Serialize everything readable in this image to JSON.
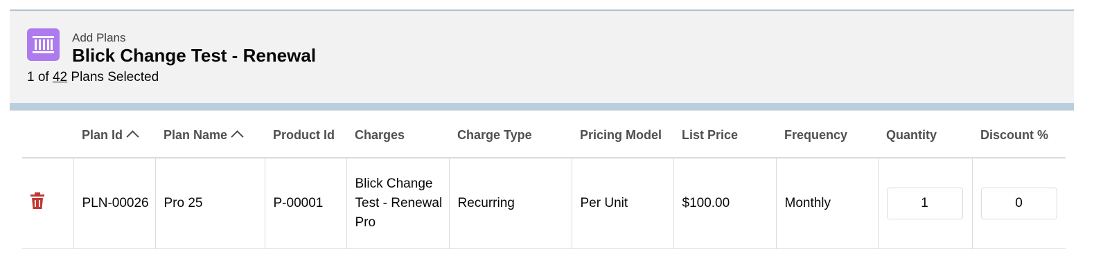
{
  "header": {
    "object_label": "Add Plans",
    "title": "Blick Change Test - Renewal",
    "selection_prefix": "1 of",
    "selection_total": "42",
    "selection_suffix": "Plans Selected",
    "icon": "plan-icon",
    "icon_color": "#ad7bee"
  },
  "table": {
    "columns": [
      {
        "label": "Plan Id",
        "sorted": "ascending"
      },
      {
        "label": "Plan Name",
        "sorted": "ascending"
      },
      {
        "label": "Product Id"
      },
      {
        "label": "Charges"
      },
      {
        "label": "Charge Type"
      },
      {
        "label": "Pricing Model"
      },
      {
        "label": "List Price"
      },
      {
        "label": "Frequency"
      },
      {
        "label": "Quantity"
      },
      {
        "label": "Discount %"
      }
    ],
    "rows": [
      {
        "delete_icon": "trash-icon",
        "plan_id": "PLN-00026",
        "plan_name": "Pro 25",
        "product_id": "P-00001",
        "charges": "Blick Change Test - Renewal Pro",
        "charge_type": "Recurring",
        "pricing_model": "Per Unit",
        "list_price": "$100.00",
        "frequency": "Monthly",
        "quantity": "1",
        "discount": "0"
      }
    ]
  },
  "colors": {
    "delete": "#c23934",
    "header_bg": "#f3f2f2"
  }
}
